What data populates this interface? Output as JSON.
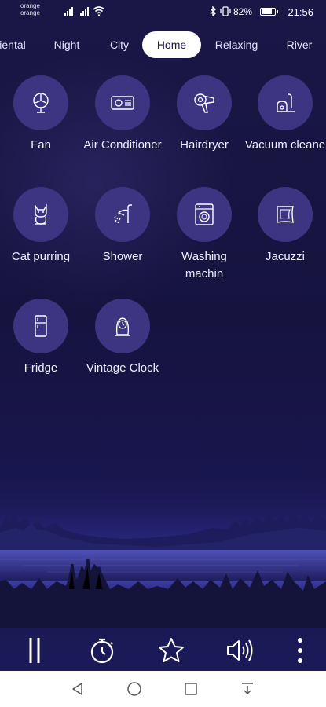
{
  "status": {
    "carrier1": "orange",
    "carrier2": "orange",
    "battery": "82%",
    "time": "21:56"
  },
  "tabs": [
    {
      "label": "iental"
    },
    {
      "label": "Night"
    },
    {
      "label": "City"
    },
    {
      "label": "Home"
    },
    {
      "label": "Relaxing"
    },
    {
      "label": "River"
    }
  ],
  "active_tab": "Home",
  "sounds": [
    {
      "label": "Fan",
      "icon": "fan-icon"
    },
    {
      "label": "Air Conditioner",
      "icon": "air-conditioner-icon"
    },
    {
      "label": "Hairdryer",
      "icon": "hairdryer-icon"
    },
    {
      "label": "Vacuum cleane",
      "icon": "vacuum-icon"
    },
    {
      "label": "Cat purring",
      "icon": "cat-icon"
    },
    {
      "label": "Shower",
      "icon": "shower-icon"
    },
    {
      "label": "Washing machin",
      "icon": "washing-machine-icon"
    },
    {
      "label": "Jacuzzi",
      "icon": "jacuzzi-icon"
    },
    {
      "label": "Fridge",
      "icon": "fridge-icon"
    },
    {
      "label": "Vintage Clock",
      "icon": "clock-icon"
    }
  ],
  "colors": {
    "background": "#16133f",
    "circle": "#3d3482",
    "active_tab_bg": "#ffffff",
    "active_tab_text": "#1a1747"
  }
}
